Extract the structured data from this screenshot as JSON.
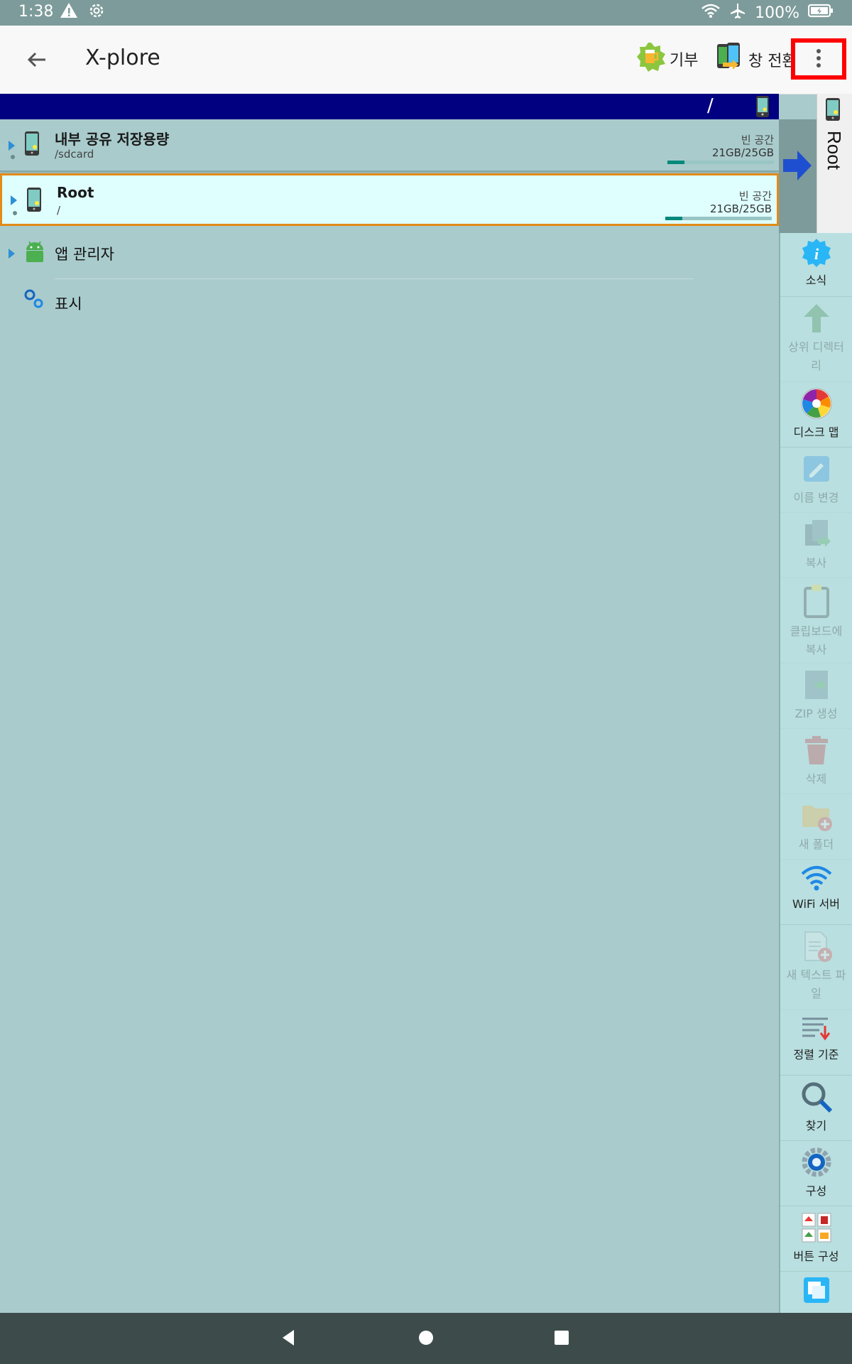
{
  "status_bar": {
    "time": "1:38",
    "battery": "100%",
    "icons": [
      "warning-icon",
      "settings-icon",
      "wifi-icon",
      "airplane-icon",
      "battery-icon"
    ]
  },
  "app_bar": {
    "title": "X-plore",
    "donate_label": "기부",
    "switch_label": "창 전환",
    "icons": [
      "back-arrow-icon",
      "beer-badge-icon",
      "phone-switch-icon",
      "more-vert-icon"
    ]
  },
  "path_bar": {
    "path": "/"
  },
  "file_list": [
    {
      "name": "내부 공유 저장용량",
      "path": "/sdcard",
      "free_label": "빈 공간",
      "free_value": "21GB/25GB",
      "used_fraction": 0.16
    },
    {
      "name": "Root",
      "path": "/",
      "free_label": "빈 공간",
      "free_value": "21GB/25GB",
      "used_fraction": 0.16
    },
    {
      "name": "앱 관리자"
    },
    {
      "name": "표시"
    }
  ],
  "side_tab": {
    "label": "Root"
  },
  "toolbar": [
    {
      "label": "소식",
      "icon": "info-icon",
      "enabled": true
    },
    {
      "label": "상위 디렉터리",
      "icon": "up-arrow-icon",
      "enabled": false
    },
    {
      "label": "디스크 맵",
      "icon": "disk-map-icon",
      "enabled": true
    },
    {
      "label": "이름 변경",
      "icon": "rename-icon",
      "enabled": false
    },
    {
      "label": "복사",
      "icon": "copy-icon",
      "enabled": false
    },
    {
      "label": "클립보드에 복사",
      "icon": "clipboard-icon",
      "enabled": false
    },
    {
      "label": "ZIP 생성",
      "icon": "zip-icon",
      "enabled": false
    },
    {
      "label": "삭제",
      "icon": "trash-icon",
      "enabled": false
    },
    {
      "label": "새 폴더",
      "icon": "new-folder-icon",
      "enabled": false
    },
    {
      "label": "WiFi 서버",
      "icon": "wifi-server-icon",
      "enabled": true
    },
    {
      "label": "새 텍스트 파일",
      "icon": "new-text-file-icon",
      "enabled": false
    },
    {
      "label": "정렬 기준",
      "icon": "sort-icon",
      "enabled": true
    },
    {
      "label": "찾기",
      "icon": "search-icon",
      "enabled": true
    },
    {
      "label": "구성",
      "icon": "config-gear-icon",
      "enabled": true
    },
    {
      "label": "버튼 구성",
      "icon": "button-config-icon",
      "enabled": true
    }
  ],
  "nav_bar": {
    "icons": [
      "nav-back-icon",
      "nav-home-icon",
      "nav-recents-icon"
    ]
  },
  "colors": {
    "path_bar": "#000080",
    "selection_border": "#e38a17",
    "highlight_box": "#ff0000",
    "list_background": "#a9cbcc"
  }
}
